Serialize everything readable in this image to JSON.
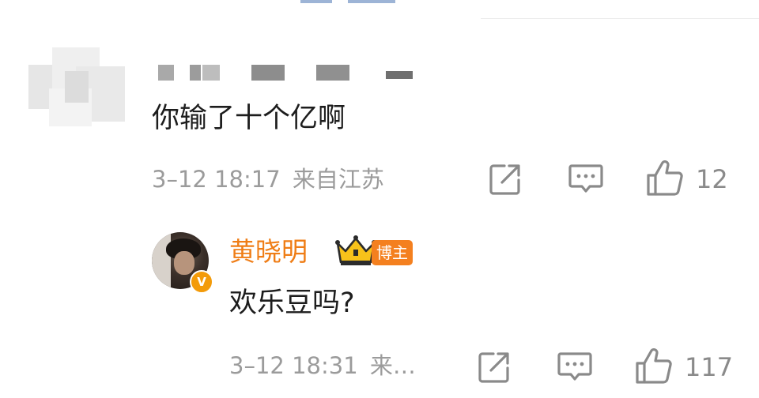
{
  "comment": {
    "text": "你输了十个亿啊",
    "time": "3–12 18:17",
    "source": "来自江苏",
    "likes": "12"
  },
  "reply": {
    "author": "黄晓明",
    "badge": "博主",
    "verified_mark": "V",
    "text": "欢乐豆吗?",
    "time": "3–12 18:31",
    "source_truncated": "来…",
    "likes": "117"
  },
  "icons": {
    "share": "share-icon",
    "comment": "comment-icon",
    "like": "thumbs-up-icon",
    "crown": "crown-icon"
  },
  "colors": {
    "author": "#ef7d16",
    "badge": "#f4801f",
    "meta": "#9b9b9b"
  }
}
